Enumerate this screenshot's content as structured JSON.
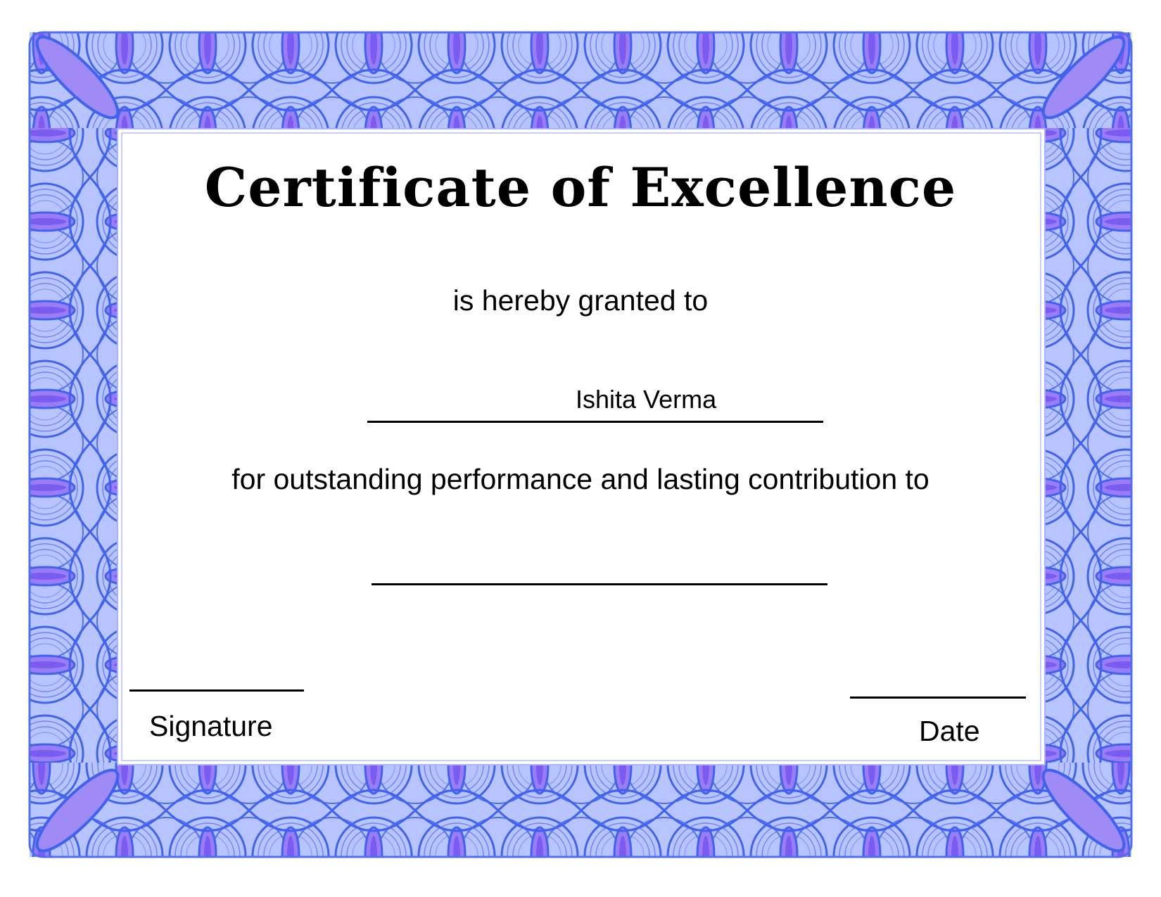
{
  "certificate": {
    "title": "Certificate of Excellence",
    "granted_text": "is hereby granted to",
    "recipient_name": "Ishita Verma",
    "purpose_text": "for outstanding performance and lasting contribution to",
    "signature_label": "Signature",
    "date_label": "Date"
  },
  "colors": {
    "border_blue": "#4f6ff0",
    "border_light": "#9fb0ff",
    "border_purple": "#8a5cf0",
    "text": "#000000"
  }
}
